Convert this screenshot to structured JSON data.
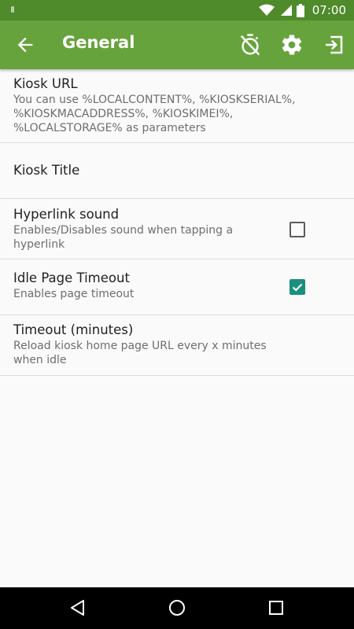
{
  "status_bar": {
    "time": "07:00",
    "icons": [
      "wifi-icon",
      "cell-signal-icon",
      "battery-icon"
    ]
  },
  "app_bar": {
    "title": "General",
    "icons": [
      "back-arrow-icon",
      "timer-off-icon",
      "gear-icon",
      "exit-icon"
    ],
    "color": "#67a33c",
    "status_color": "#4f8a2b"
  },
  "preferences": [
    {
      "title": "Kiosk URL",
      "summary": "You can use %LOCALCONTENT%, %KIOSKSERIAL%, %KIOSKMACADDRESS%, %KIOSKIMEI%, %LOCALSTORAGE% as parameters"
    },
    {
      "title": "Kiosk Title",
      "summary": ""
    },
    {
      "title": "Hyperlink sound",
      "summary": "Enables/Disables sound when tapping a hyperlink",
      "checked": false
    },
    {
      "title": "Idle Page Timeout",
      "summary": "Enables page timeout",
      "checked": true
    },
    {
      "title": "Timeout (minutes)",
      "summary": "Reload kiosk home page URL every x minutes when idle"
    }
  ],
  "checkbox_color": "#1a8f7e",
  "nav_bar": {
    "icons": [
      "nav-back-icon",
      "nav-home-icon",
      "nav-recents-icon"
    ]
  }
}
